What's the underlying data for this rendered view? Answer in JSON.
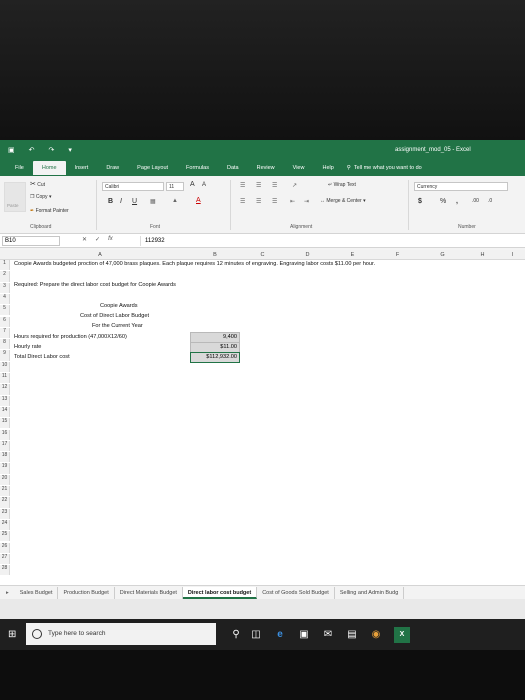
{
  "window": {
    "title": "assignment_mod_05  -  Excel"
  },
  "ribbon_tabs": [
    "File",
    "Home",
    "Insert",
    "Draw",
    "Page Layout",
    "Formulas",
    "Data",
    "Review",
    "View",
    "Help"
  ],
  "tell_me": "Tell me what you want to do",
  "clipboard": {
    "cut": "Cut",
    "copy": "Copy",
    "format_painter": "Format Painter",
    "paste": "Paste",
    "label": "Clipboard"
  },
  "font": {
    "name": "Calibri",
    "size": "11",
    "label": "Font"
  },
  "alignment": {
    "wrap_text": "Wrap Text",
    "merge_center": "Merge & Center",
    "label": "Alignment"
  },
  "number": {
    "format": "Currency",
    "label": "Number"
  },
  "formula_bar": {
    "name_box": "B10",
    "content": "112932"
  },
  "columns": [
    "A",
    "B",
    "C",
    "D",
    "E",
    "F",
    "G",
    "H",
    "I"
  ],
  "rows": [
    "1",
    "2",
    "3",
    "4",
    "5",
    "6",
    "7",
    "8",
    "9",
    "10",
    "11",
    "12",
    "13",
    "14",
    "15",
    "16",
    "17",
    "18",
    "19",
    "20",
    "21",
    "22",
    "23",
    "24",
    "25",
    "26",
    "27",
    "28"
  ],
  "cells": {
    "r1": "Coopie Awards budgeted proction of 47,000 brass plaques. Each plaque requires 12 minutes of engraving. Engraving labor costs $11.00 per hour.",
    "r3": "Required: Prepare the direct labor cost budget for Coopie Awards",
    "r5": "Coopie Awards",
    "r6": "Cost of Direct Labor Budget",
    "r7": "For the Current Year",
    "r8_label": "Hours required for production (47,000X12/60)",
    "r8_value": "9,400",
    "r9_label": "Hourly rate",
    "r9_value": "$11.00",
    "r10_label": "Total Direct Labor cost",
    "r10_value": "$112,932.00"
  },
  "sheet_tabs": [
    "Sales Budget",
    "Production Budget",
    "Direct Materials Budget",
    "Direct labor cost budget",
    "Cost of Goods Sold Budget",
    "Selling and Admin Budg"
  ],
  "active_sheet": "Direct labor cost budget",
  "taskbar": {
    "search_placeholder": "Type here to search"
  },
  "colors": {
    "excel_green": "#217346",
    "cell_shade": "#d9d9d9"
  }
}
